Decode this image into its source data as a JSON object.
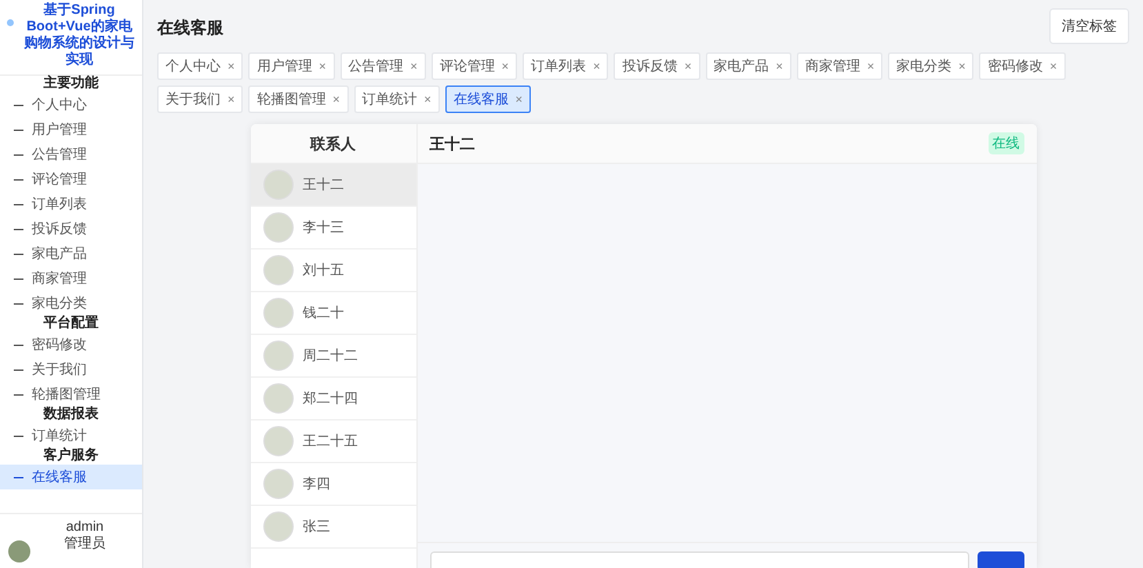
{
  "sidebar": {
    "title": "基于Spring Boot+Vue的家电购物系统的设计与实现",
    "groups": [
      {
        "label": "主要功能",
        "items": [
          {
            "label": "个人中心",
            "selected": false
          },
          {
            "label": "用户管理",
            "selected": false
          },
          {
            "label": "公告管理",
            "selected": false
          },
          {
            "label": "评论管理",
            "selected": false
          },
          {
            "label": "订单列表",
            "selected": false
          },
          {
            "label": "投诉反馈",
            "selected": false
          },
          {
            "label": "家电产品",
            "selected": false
          },
          {
            "label": "商家管理",
            "selected": false
          },
          {
            "label": "家电分类",
            "selected": false
          }
        ]
      },
      {
        "label": "平台配置",
        "items": [
          {
            "label": "密码修改",
            "selected": false
          },
          {
            "label": "关于我们",
            "selected": false
          },
          {
            "label": "轮播图管理",
            "selected": false
          }
        ]
      },
      {
        "label": "数据报表",
        "items": [
          {
            "label": "订单统计",
            "selected": false
          }
        ]
      },
      {
        "label": "客户服务",
        "items": [
          {
            "label": "在线客服",
            "selected": true
          }
        ]
      }
    ],
    "user": {
      "name": "admin",
      "role": "管理员"
    }
  },
  "page_title": "在线客服",
  "clear_tabs_button": "清空标签",
  "tabs": [
    {
      "label": "个人中心",
      "close": "×",
      "selected": false
    },
    {
      "label": "用户管理",
      "close": "×",
      "selected": false
    },
    {
      "label": "公告管理",
      "close": "×",
      "selected": false
    },
    {
      "label": "评论管理",
      "close": "×",
      "selected": false
    },
    {
      "label": "订单列表",
      "close": "×",
      "selected": false
    },
    {
      "label": "投诉反馈",
      "close": "×",
      "selected": false
    },
    {
      "label": "家电产品",
      "close": "×",
      "selected": false
    },
    {
      "label": "商家管理",
      "close": "×",
      "selected": false
    },
    {
      "label": "家电分类",
      "close": "×",
      "selected": false
    },
    {
      "label": "密码修改",
      "close": "×",
      "selected": false
    },
    {
      "label": "关于我们",
      "close": "×",
      "selected": false
    },
    {
      "label": "轮播图管理",
      "close": "×",
      "selected": false
    },
    {
      "label": "订单统计",
      "close": "×",
      "selected": false
    },
    {
      "label": "在线客服",
      "close": "×",
      "selected": true
    }
  ],
  "chat": {
    "contacts_title": "联系人",
    "contacts": [
      {
        "name": "王十二",
        "selected": true
      },
      {
        "name": "李十三",
        "selected": false
      },
      {
        "name": "刘十五",
        "selected": false
      },
      {
        "name": "钱二十",
        "selected": false
      },
      {
        "name": "周二十二",
        "selected": false
      },
      {
        "name": "郑二十四",
        "selected": false
      },
      {
        "name": "王二十五",
        "selected": false
      },
      {
        "name": "李四",
        "selected": false
      },
      {
        "name": "张三",
        "selected": false
      }
    ],
    "current_contact": "王十二",
    "status": "在线"
  }
}
